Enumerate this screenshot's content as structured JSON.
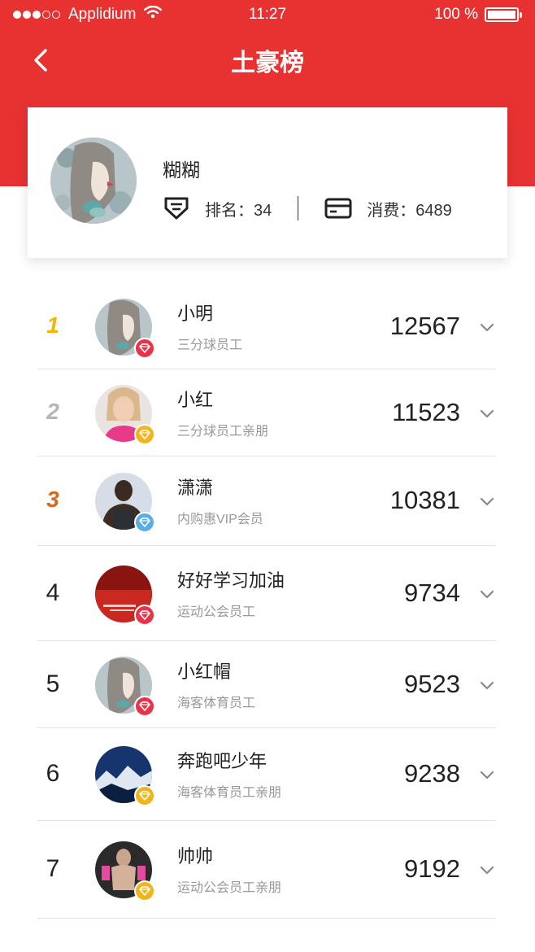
{
  "status_bar": {
    "carrier": "Applidium",
    "time": "11:27",
    "battery": "100 %"
  },
  "nav": {
    "title": "土豪榜",
    "back_icon": "chevron-left-icon"
  },
  "profile": {
    "name": "糊糊",
    "rank_label": "排名：34",
    "spend_label": "消费：6489",
    "rank_icon": "rank-badge-icon",
    "spend_icon": "card-icon"
  },
  "ranking": [
    {
      "rank": "1",
      "name": "小明",
      "subtitle": "三分球员工",
      "score": "12567",
      "badge": "red"
    },
    {
      "rank": "2",
      "name": "小红",
      "subtitle": "三分球员工亲朋",
      "score": "11523",
      "badge": "gold"
    },
    {
      "rank": "3",
      "name": "潇潇",
      "subtitle": "内购惠VIP会员",
      "score": "10381",
      "badge": "blue"
    },
    {
      "rank": "4",
      "name": "好好学习加油",
      "subtitle": "运动公会员工",
      "score": "9734",
      "badge": "red"
    },
    {
      "rank": "5",
      "name": "小红帽",
      "subtitle": "海客体育员工",
      "score": "9523",
      "badge": "red"
    },
    {
      "rank": "6",
      "name": "奔跑吧少年",
      "subtitle": "海客体育员工亲朋",
      "score": "9238",
      "badge": "gold"
    },
    {
      "rank": "7",
      "name": "帅帅",
      "subtitle": "运动公会员工亲朋",
      "score": "9192",
      "badge": "gold"
    }
  ],
  "colors": {
    "brand_red": "#e83232",
    "rank1": "#f5b400",
    "rank2": "#b5b5b5",
    "rank3": "#d2691e",
    "badge_red": "#e8334a",
    "badge_gold": "#f1b51c",
    "badge_blue": "#5aaee6"
  }
}
